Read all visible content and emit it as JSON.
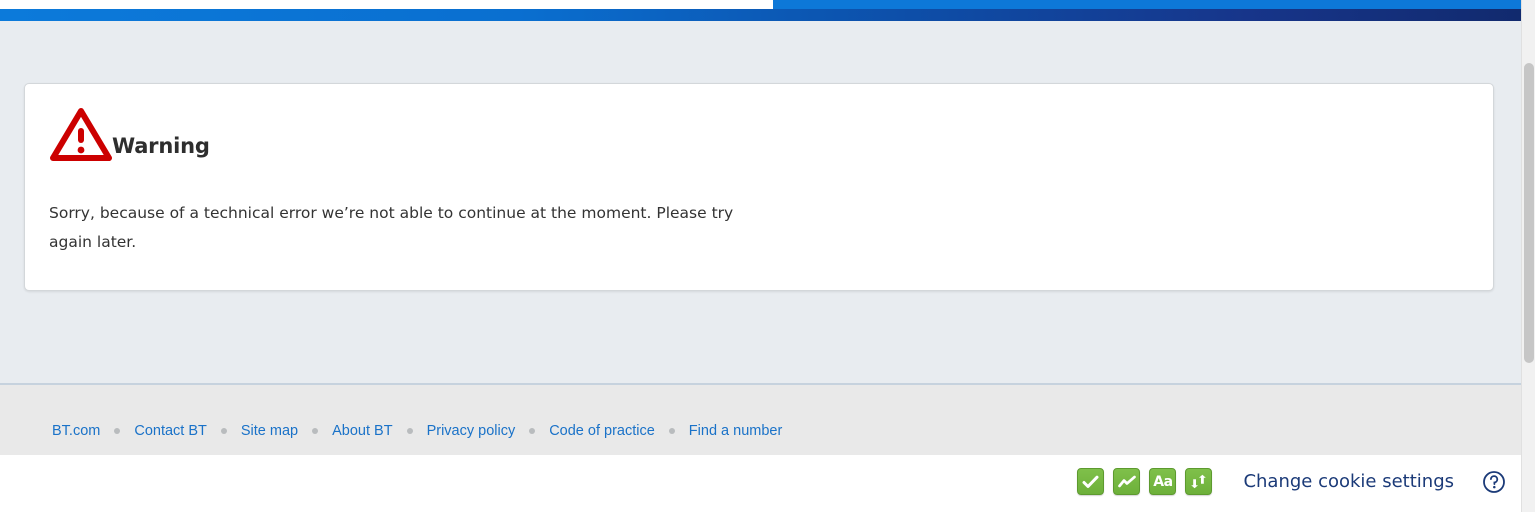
{
  "brand": {
    "accent_bright_blue": "#0d78d8",
    "accent_dark_navy": "#112a6e"
  },
  "main": {
    "warning_card": {
      "icon": "warning-triangle-icon",
      "title": "Warning",
      "message": "Sorry, because of a technical error we’re not able to continue at the moment. Please try again later.",
      "icon_color": "#cc0000"
    }
  },
  "footer": {
    "links": [
      {
        "label": "BT.com"
      },
      {
        "label": "Contact BT"
      },
      {
        "label": "Site map"
      },
      {
        "label": "About BT"
      },
      {
        "label": "Privacy policy"
      },
      {
        "label": "Code of practice"
      },
      {
        "label": "Find a number"
      }
    ],
    "link_color": "#1a72c8"
  },
  "bottom_bar": {
    "accessibility_buttons": [
      {
        "icon": "checkmark-icon",
        "name": "accessibility-check-button"
      },
      {
        "icon": "zigzag-line-icon",
        "name": "accessibility-contrast-button"
      },
      {
        "icon": "text-size-aa-icon",
        "label": "Aa",
        "name": "text-size-button"
      },
      {
        "icon": "swap-arrows-icon",
        "name": "accessibility-swap-button"
      }
    ],
    "button_color": "#6db03a",
    "cookie_settings_label": "Change cookie settings",
    "help_icon": "question-mark-circle-icon",
    "help_icon_color": "#1b3a78"
  }
}
